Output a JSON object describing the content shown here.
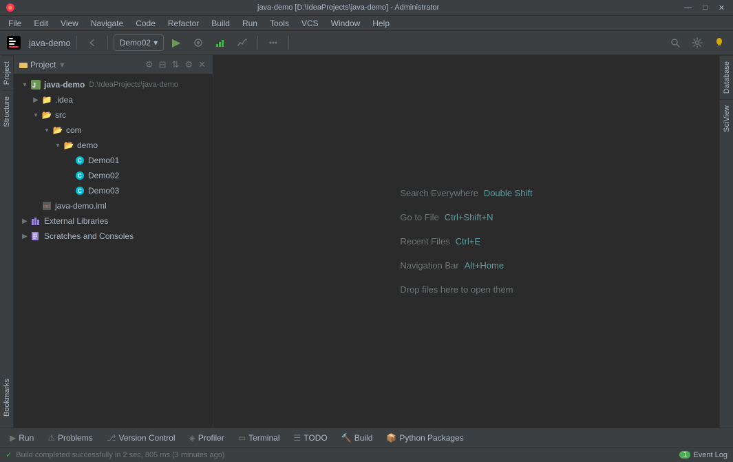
{
  "titlebar": {
    "title": "java-demo [D:\\IdeaProjects\\java-demo] - Administrator",
    "controls": [
      "—",
      "□",
      "✕"
    ]
  },
  "menubar": {
    "items": [
      "File",
      "Edit",
      "View",
      "Navigate",
      "Code",
      "Refactor",
      "Build",
      "Run",
      "Tools",
      "VCS",
      "Window",
      "Help"
    ]
  },
  "toolbar": {
    "project_name": "java-demo",
    "run_config": "Demo02",
    "run_config_arrow": "▾"
  },
  "project_panel": {
    "title": "Project",
    "root": {
      "name": "java-demo",
      "path": "D:\\IdeaProjects\\java-demo"
    },
    "tree": [
      {
        "label": "java-demo",
        "path": "D:\\IdeaProjects\\java-demo",
        "type": "project-root",
        "indent": 0,
        "expanded": true
      },
      {
        "label": ".idea",
        "type": "folder",
        "indent": 1,
        "expanded": false
      },
      {
        "label": "src",
        "type": "folder",
        "indent": 1,
        "expanded": true
      },
      {
        "label": "com",
        "type": "folder",
        "indent": 2,
        "expanded": true
      },
      {
        "label": "demo",
        "type": "folder",
        "indent": 3,
        "expanded": true
      },
      {
        "label": "Demo01",
        "type": "java",
        "indent": 4
      },
      {
        "label": "Demo02",
        "type": "java",
        "indent": 4
      },
      {
        "label": "Demo03",
        "type": "java",
        "indent": 4
      },
      {
        "label": "java-demo.iml",
        "type": "xml",
        "indent": 1
      },
      {
        "label": "External Libraries",
        "type": "lib",
        "indent": 0,
        "expanded": false
      },
      {
        "label": "Scratches and Consoles",
        "type": "scratches",
        "indent": 0,
        "expanded": false
      }
    ]
  },
  "editor": {
    "hints": [
      {
        "label": "Search Everywhere",
        "shortcut": "Double Shift"
      },
      {
        "label": "Go to File",
        "shortcut": "Ctrl+Shift+N"
      },
      {
        "label": "Recent Files",
        "shortcut": "Ctrl+E"
      },
      {
        "label": "Navigation Bar",
        "shortcut": "Alt+Home"
      },
      {
        "label": "Drop files here to open them",
        "shortcut": ""
      }
    ]
  },
  "right_sidebar": {
    "tabs": [
      "Database",
      "SciView"
    ]
  },
  "left_sidebar": {
    "tabs": [
      "Project",
      "Structure",
      "Bookmarks"
    ]
  },
  "bottom_tabs": {
    "items": [
      {
        "label": "Run",
        "icon": "▶"
      },
      {
        "label": "Problems",
        "icon": "⚠"
      },
      {
        "label": "Version Control",
        "icon": "⎇"
      },
      {
        "label": "Profiler",
        "icon": "◈"
      },
      {
        "label": "Terminal",
        "icon": "▭"
      },
      {
        "label": "TODO",
        "icon": "☰"
      },
      {
        "label": "Build",
        "icon": "🔨"
      },
      {
        "label": "Python Packages",
        "icon": "📦"
      }
    ]
  },
  "status_bar": {
    "message": "Build completed successfully in 2 sec, 805 ms (3 minutes ago)",
    "event_log_label": "Event Log",
    "event_log_count": "1"
  }
}
